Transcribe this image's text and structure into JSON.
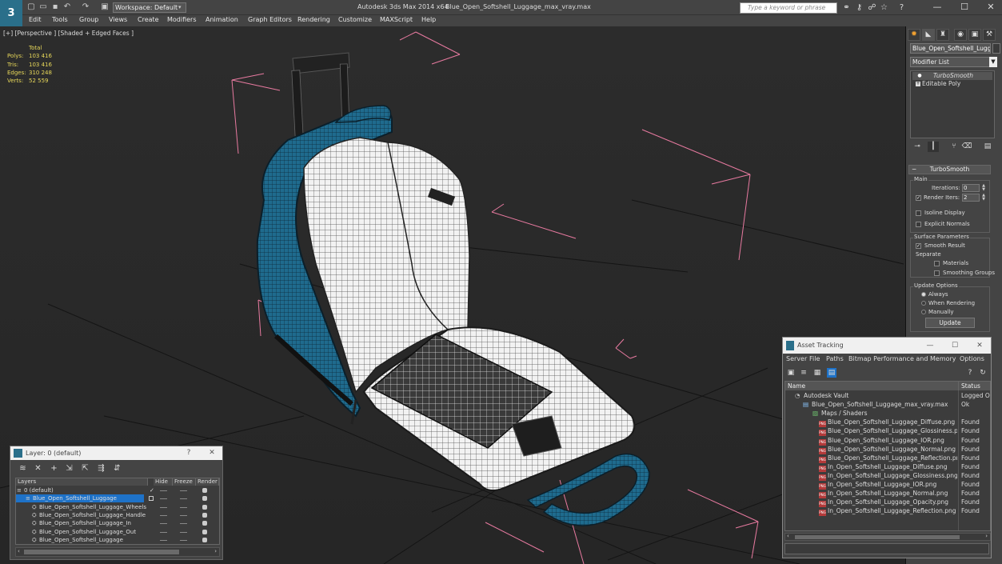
{
  "titlebar": {
    "workspace_label": "Workspace: Default",
    "app_title": "Autodesk 3ds Max  2014 x64",
    "file_title": "Blue_Open_Softshell_Luggage_max_vray.max",
    "search_placeholder": "Type a keyword or phrase"
  },
  "menu": [
    "Edit",
    "Tools",
    "Group",
    "Views",
    "Create",
    "Modifiers",
    "Animation",
    "Graph Editors",
    "Rendering",
    "Customize",
    "MAXScript",
    "Help"
  ],
  "viewport": {
    "label": "[+] [Perspective ] [Shaded + Edged Faces ]",
    "stats_header": "Total",
    "stats": [
      {
        "k": "Polys:",
        "v": "103 416"
      },
      {
        "k": "Tris:",
        "v": "103 416"
      },
      {
        "k": "Edges:",
        "v": "310 248"
      },
      {
        "k": "Verts:",
        "v": "52 559"
      }
    ]
  },
  "command_panel": {
    "object_name": "Blue_Open_Softshell_Luggag",
    "modifier_list": "Modifier List",
    "stack": [
      "TurboSmooth",
      "Editable Poly"
    ],
    "rollout_title": "TurboSmooth",
    "main_group": "Main",
    "iterations_label": "Iterations:",
    "iterations_value": "0",
    "render_iters_label": "Render Iters:",
    "render_iters_value": "2",
    "isoline_label": "Isoline Display",
    "explicit_normals_label": "Explicit Normals",
    "surface_group": "Surface Parameters",
    "smooth_result_label": "Smooth Result",
    "separate_label": "Separate",
    "materials_label": "Materials",
    "smoothing_groups_label": "Smoothing Groups",
    "update_group": "Update Options",
    "always_label": "Always",
    "when_rendering_label": "When Rendering",
    "manually_label": "Manually",
    "update_button": "Update"
  },
  "layer_dialog": {
    "title": "Layer: 0 (default)",
    "help": "?",
    "close": "✕",
    "columns": [
      "Layers",
      "Hide",
      "Freeze",
      "Render"
    ],
    "rows": [
      {
        "name": "0 (default)",
        "indent": 1,
        "selected": false
      },
      {
        "name": "Blue_Open_Softshell_Luggage",
        "indent": 0,
        "selected": true
      },
      {
        "name": "Blue_Open_Softshell_Luggage_Wheels",
        "indent": 2,
        "selected": false
      },
      {
        "name": "Blue_Open_Softshell_Luggage_Handle",
        "indent": 2,
        "selected": false
      },
      {
        "name": "Blue_Open_Softshell_Luggage_In",
        "indent": 2,
        "selected": false
      },
      {
        "name": "Blue_Open_Softshell_Luggage_Out",
        "indent": 2,
        "selected": false
      },
      {
        "name": "Blue_Open_Softshell_Luggage",
        "indent": 2,
        "selected": false
      }
    ]
  },
  "asset_tracking": {
    "title": "Asset Tracking",
    "menu": [
      "Server",
      "File",
      "Paths",
      "Bitmap Performance and Memory",
      "Options"
    ],
    "columns": [
      "Name",
      "Status"
    ],
    "rows": [
      {
        "name": "Autodesk Vault",
        "status": "Logged Ou",
        "indent": 1,
        "type": "vault"
      },
      {
        "name": "Blue_Open_Softshell_Luggage_max_vray.max",
        "status": "Ok",
        "indent": 2,
        "type": "max"
      },
      {
        "name": "Maps / Shaders",
        "status": "",
        "indent": 3,
        "type": "folder"
      },
      {
        "name": "Blue_Open_Softshell_Luggage_Diffuse.png",
        "status": "Found",
        "indent": 4,
        "type": "png"
      },
      {
        "name": "Blue_Open_Softshell_Luggage_Glossiness.png",
        "status": "Found",
        "indent": 4,
        "type": "png"
      },
      {
        "name": "Blue_Open_Softshell_Luggage_IOR.png",
        "status": "Found",
        "indent": 4,
        "type": "png"
      },
      {
        "name": "Blue_Open_Softshell_Luggage_Normal.png",
        "status": "Found",
        "indent": 4,
        "type": "png"
      },
      {
        "name": "Blue_Open_Softshell_Luggage_Reflection.png",
        "status": "Found",
        "indent": 4,
        "type": "png"
      },
      {
        "name": "In_Open_Softshell_Luggage_Diffuse.png",
        "status": "Found",
        "indent": 4,
        "type": "png"
      },
      {
        "name": "In_Open_Softshell_Luggage_Glossiness.png",
        "status": "Found",
        "indent": 4,
        "type": "png"
      },
      {
        "name": "In_Open_Softshell_Luggage_IOR.png",
        "status": "Found",
        "indent": 4,
        "type": "png"
      },
      {
        "name": "In_Open_Softshell_Luggage_Normal.png",
        "status": "Found",
        "indent": 4,
        "type": "png"
      },
      {
        "name": "In_Open_Softshell_Luggage_Opacity.png",
        "status": "Found",
        "indent": 4,
        "type": "png"
      },
      {
        "name": "In_Open_Softshell_Luggage_Reflection.png",
        "status": "Found",
        "indent": 4,
        "type": "png"
      }
    ]
  },
  "colors": {
    "accent": "#2a6f8a",
    "selection": "#1e72c8",
    "stats_text": "#e8d85a",
    "bbox_lines": "#e87aa0",
    "luggage_shell": "#1f6b8e"
  }
}
